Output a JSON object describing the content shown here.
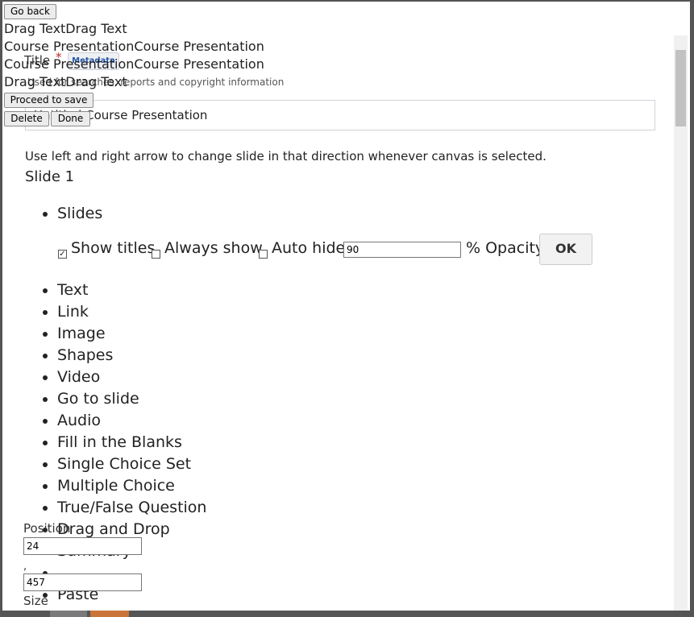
{
  "top_buttons": {
    "go_back": "Go back",
    "proceed_to_save": "Proceed to save",
    "delete": "Delete",
    "done": "Done"
  },
  "overlay_lines": [
    "Drag TextDrag Text",
    "Course PresentationCourse Presentation",
    "Course PresentationCourse Presentation",
    "Drag TextDrag Text"
  ],
  "title_field": {
    "label": "Title",
    "required_mark": "*",
    "metadata_button": "Metadata",
    "help_text": "Used for searches, reports and copyright information",
    "value": "Untitled Course Presentation"
  },
  "editor": {
    "instruction": "Use left and right arrow to change slide in that direction whenever canvas is selected.",
    "slide_label": "Slide 1",
    "tools": [
      "Slides",
      "Text",
      "Link",
      "Image",
      "Shapes",
      "Video",
      "Go to slide",
      "Audio",
      "Fill in the Blanks",
      "Single Choice Set",
      "Multiple Choice",
      "True/False Question",
      "Drag and Drop",
      "Summary",
      "",
      "Paste"
    ],
    "slide_options": {
      "show_titles": "Show titles",
      "show_titles_checked": true,
      "always_show": "Always show",
      "auto_hide": "Auto hide",
      "opacity_value": "90",
      "opacity_label": "% Opacity",
      "ok_button": "OK"
    }
  },
  "position_panel": {
    "position_label": "Position",
    "x_value": "24",
    "comma": ",",
    "y_value": "457",
    "size_label": "Size"
  }
}
